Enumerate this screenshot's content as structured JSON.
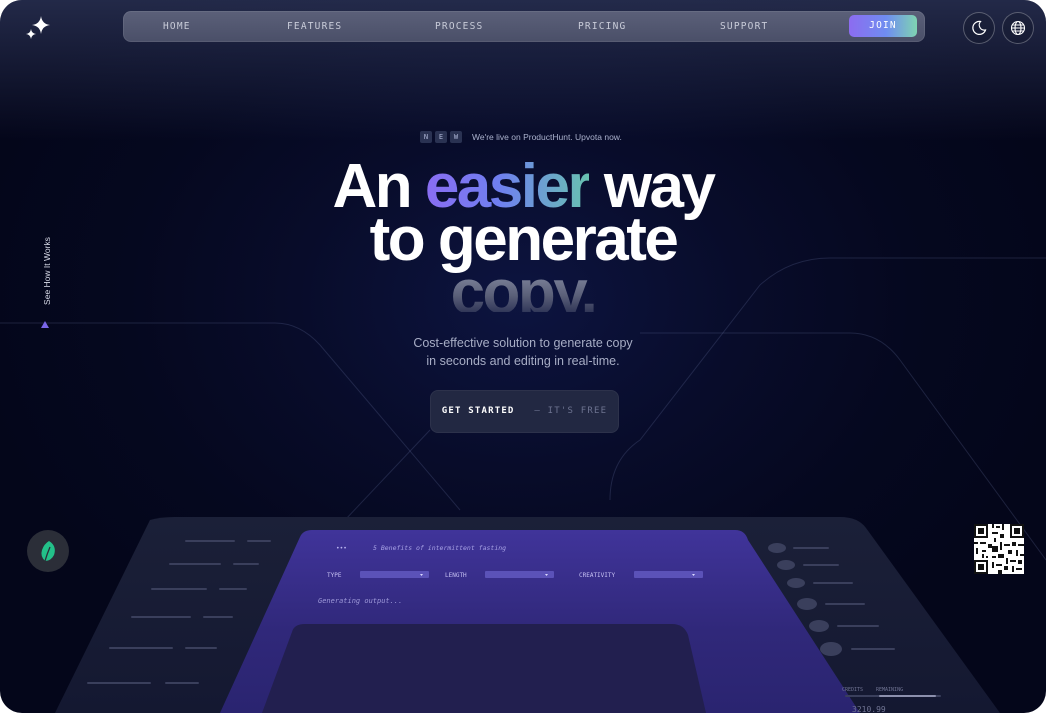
{
  "nav": {
    "items": [
      "HOME",
      "FEATURES",
      "PROCESS",
      "PRICING",
      "SUPPORT"
    ],
    "join_label": "JOIN"
  },
  "icons": {
    "logo": "sparkles-icon",
    "theme_toggle": "moon-icon",
    "language": "globe-icon",
    "floating_button": "leaf-icon",
    "qr": "qr-code-icon",
    "side_arrow": "triangle-up-icon"
  },
  "badge": {
    "letters": [
      "N",
      "E",
      "W"
    ],
    "text": "We're live on ProductHunt. Upvota now."
  },
  "hero": {
    "line1_pre": "An ",
    "line1_accent": "easier",
    "line1_post": " way",
    "line2": "to generate",
    "line3": "copy."
  },
  "subtitle": {
    "line1": "Cost-effective solution to generate copy",
    "line2": "in seconds and editing in real-time."
  },
  "cta": {
    "primary": "GET STARTED",
    "secondary": "— IT'S FREE"
  },
  "side_link": "See How It Works",
  "preview": {
    "title_prefix": "•••",
    "title": "5 Benefits of intermittent fasting",
    "fields": [
      "TYPE",
      "LENGTH",
      "CREATIVITY"
    ],
    "status": "Generating output...",
    "right_labels": [
      "CREDITS",
      "REMAINING"
    ],
    "right_number": "3210.99"
  },
  "colors": {
    "background": "#05081f",
    "accent_start": "#8a6df2",
    "accent_end": "#68c2b0",
    "panel_purple": "#3a2f8e",
    "nav_bg": "#555a73"
  }
}
